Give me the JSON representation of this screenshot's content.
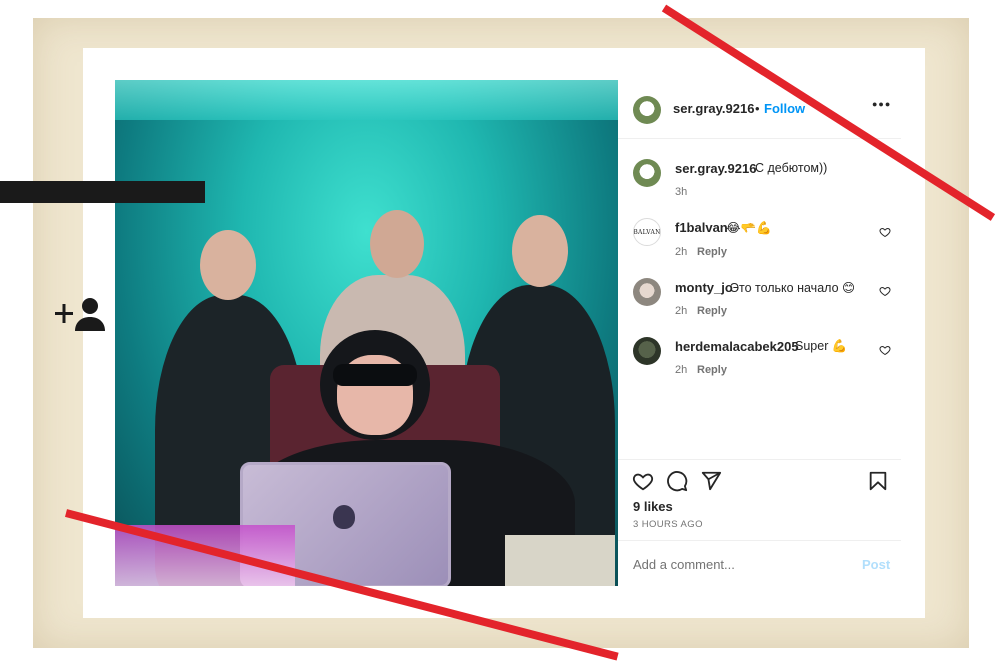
{
  "post": {
    "username": "ser.gray.9216",
    "follow_label": "Follow",
    "dot": "•",
    "more_label": "•••",
    "caption": {
      "username": "ser.gray.9216",
      "text": "С дебютом))",
      "time": "3h"
    },
    "comments": [
      {
        "username": "f1balvan",
        "text": "😂🫳💪",
        "time": "2h",
        "reply": "Reply",
        "avatar_text": "BALVAN"
      },
      {
        "username": "monty_jo",
        "text": "Это только начало 😊",
        "time": "2h",
        "reply": "Reply"
      },
      {
        "username": "herdemalacabek205",
        "text": "Super 💪",
        "time": "2h",
        "reply": "Reply"
      }
    ],
    "likes": "9 likes",
    "timestamp": "3 HOURS AGO",
    "comment_placeholder": "Add a comment...",
    "post_label": "Post"
  },
  "icons": {
    "heart": "heart-icon",
    "comment": "comment-icon",
    "share": "share-icon",
    "bookmark": "bookmark-icon",
    "more": "more-icon",
    "add_person": "add-person-icon"
  },
  "colors": {
    "follow_blue": "#0095f6",
    "post_disabled_blue": "#b2dffc",
    "slash_red": "#e3242b",
    "paper": "#efe6cf"
  }
}
